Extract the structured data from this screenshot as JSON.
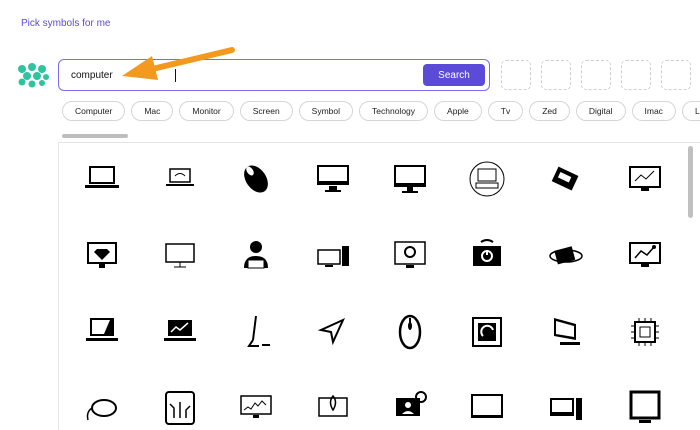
{
  "header": {
    "pick_link": "Pick symbols for me"
  },
  "search": {
    "value": "computer",
    "button_label": "Search"
  },
  "tags": [
    "Computer",
    "Mac",
    "Monitor",
    "Screen",
    "Symbol",
    "Technology",
    "Apple",
    "Tv",
    "Zed",
    "Digital",
    "Imac",
    "Lcd"
  ],
  "colors": {
    "accent": "#5b4bd6",
    "logo": "#2ec4a0",
    "arrow": "#f39a1e"
  },
  "results": {
    "rows": [
      [
        "laptop-icon",
        "laptop-wifi-icon",
        "computer-mouse-icon",
        "monitor-icon",
        "imac-icon",
        "retro-computer-icon",
        "circuit-board-icon",
        "monitor-chart-icon"
      ],
      [
        "diamond-monitor-icon",
        "monitor-outline-icon",
        "person-laptop-icon",
        "desktop-tower-icon",
        "monitor-gear-icon",
        "monitor-power-icon",
        "computer-orbit-icon",
        "monitor-line-chart-icon"
      ],
      [
        "laptop-open-icon",
        "laptop-chart-icon",
        "imac-side-icon",
        "cursor-arrow-icon",
        "mouse-top-icon",
        "cpu-chip-icon",
        "desktop-angle-icon",
        "processor-icon"
      ],
      [
        "mouse-cable-icon",
        "circuit-icon",
        "monitor-stock-icon",
        "monitor-rocket-icon",
        "laptop-user-icon",
        "tv-screen-icon",
        "desktop-pc-icon",
        "square-monitor-icon"
      ]
    ]
  }
}
